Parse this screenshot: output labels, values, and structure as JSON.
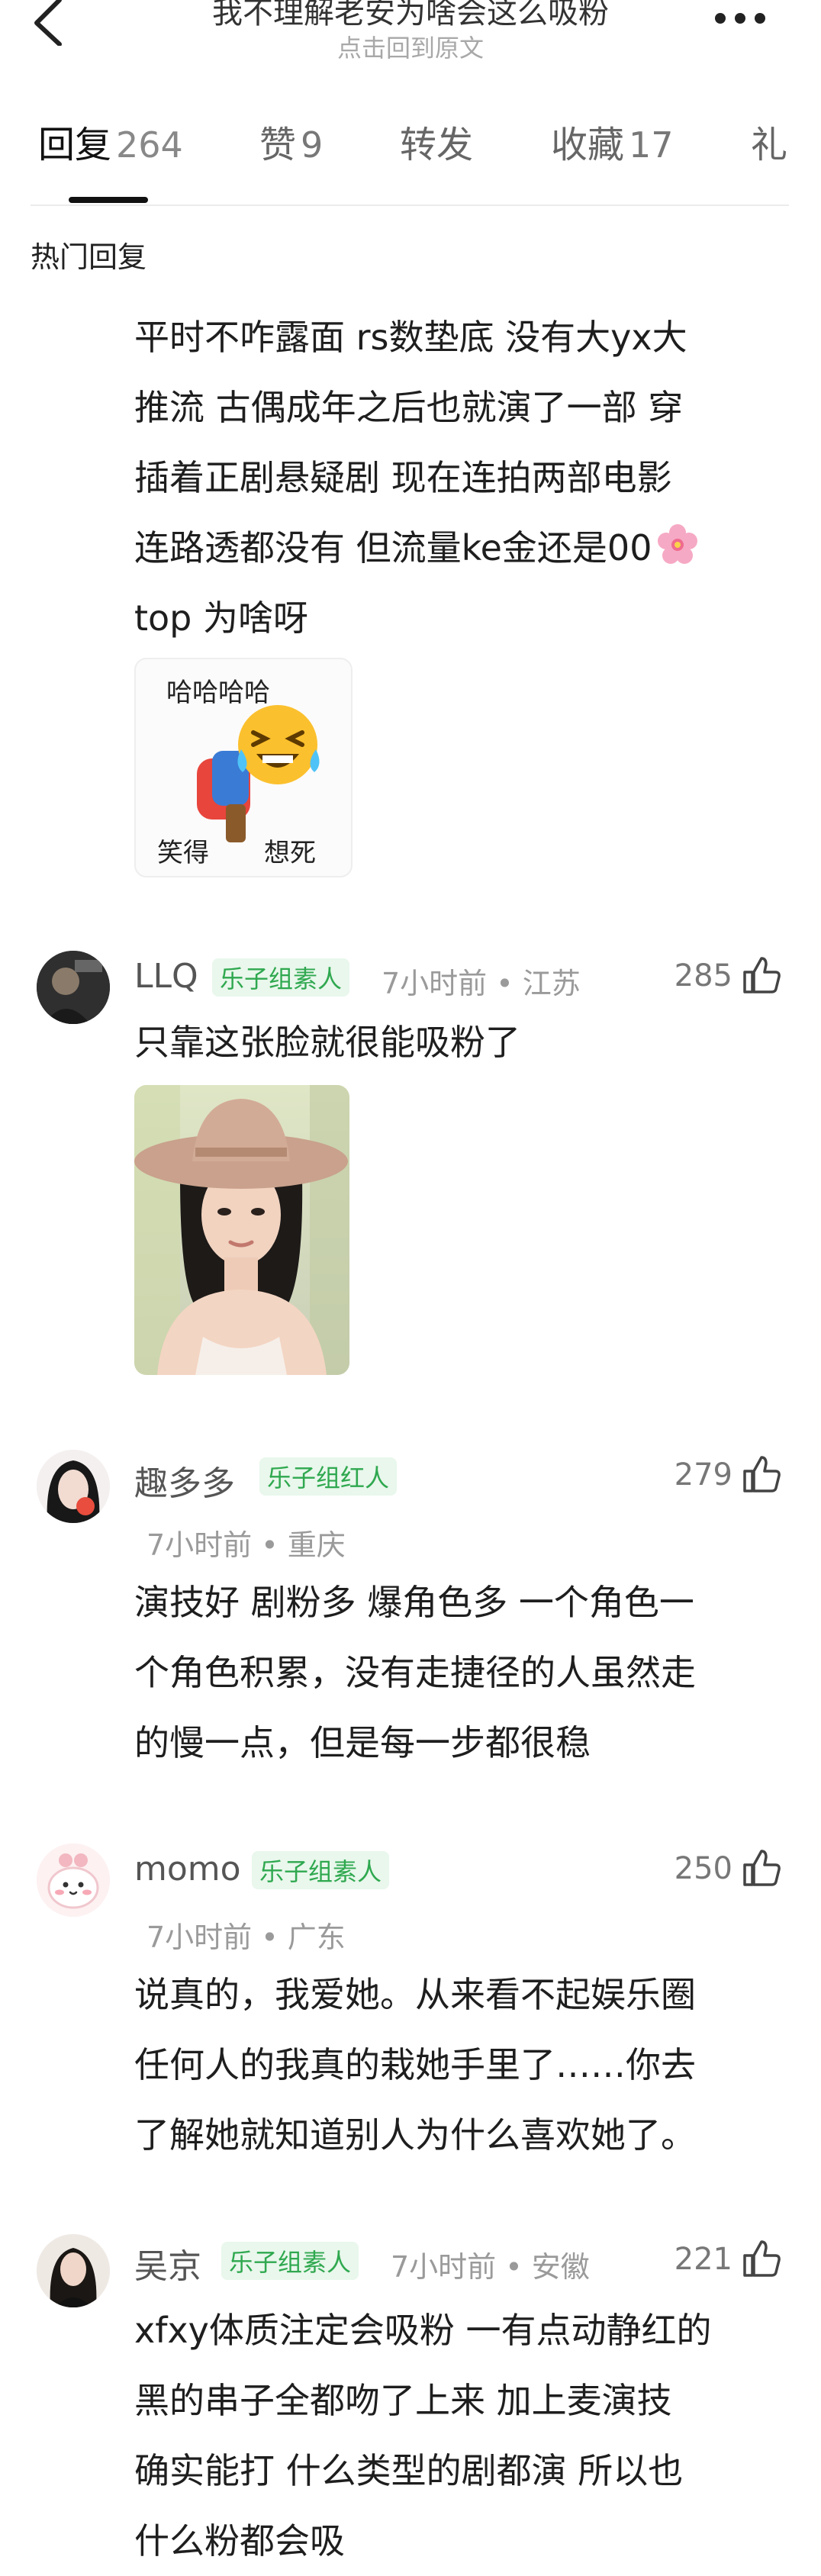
{
  "nav": {
    "title": "我不理解老安为啥会这么吸粉",
    "subtitle": "点击回到原文"
  },
  "tabs": [
    {
      "label": "回复",
      "count": "264",
      "active": true
    },
    {
      "label": "赞",
      "count": "9"
    },
    {
      "label": "转发",
      "count": ""
    },
    {
      "label": "收藏",
      "count": "17"
    },
    {
      "label": "礼",
      "count": ""
    }
  ],
  "section_title": "热门回复",
  "post": {
    "lines": [
      "平时不咋露面 rs数垫底 没有大yx大",
      "推流 古偶成年之后也就演了一部 穿",
      "插着正剧悬疑剧 现在连拍两部电影",
      "连路透都没有 但流量ke金还是00",
      "top 为啥呀"
    ],
    "sticker_top": "哈哈哈哈",
    "sticker_bottom_left": "笑得",
    "sticker_bottom_right": "想死"
  },
  "comments": [
    {
      "user": "LLQ",
      "badge": "乐子组素人",
      "meta": "7小时前 • 江苏",
      "likes": "285",
      "lines": [
        "只靠这张脸就很能吸粉了"
      ]
    },
    {
      "user": "趣多多",
      "badge": "乐子组红人",
      "meta": "7小时前 • 重庆",
      "likes": "279",
      "lines": [
        "演技好 剧粉多 爆角色多 一个角色一",
        "个角色积累，没有走捷径的人虽然走",
        "的慢一点，但是每一步都很稳"
      ]
    },
    {
      "user": "momo",
      "badge": "乐子组素人",
      "meta": "7小时前 • 广东",
      "likes": "250",
      "lines": [
        "说真的，我爱她。从来看不起娱乐圈",
        "任何人的我真的栽她手里了……你去",
        "了解她就知道别人为什么喜欢她了。"
      ]
    },
    {
      "user": "吴京",
      "badge": "乐子组素人",
      "meta": "7小时前 • 安徽",
      "likes": "221",
      "lines": [
        "xfxy体质注定会吸粉 一有点动静红的",
        "黑的串子全都吻了上来 加上麦演技",
        "确实能打 什么类型的剧都演 所以也",
        "什么粉都会吸"
      ]
    }
  ],
  "colors": {
    "badge_text": "#2fa84f",
    "badge_bg": "#e9f7ec",
    "muted": "#9a9a9a",
    "active_tab": "#111111"
  }
}
